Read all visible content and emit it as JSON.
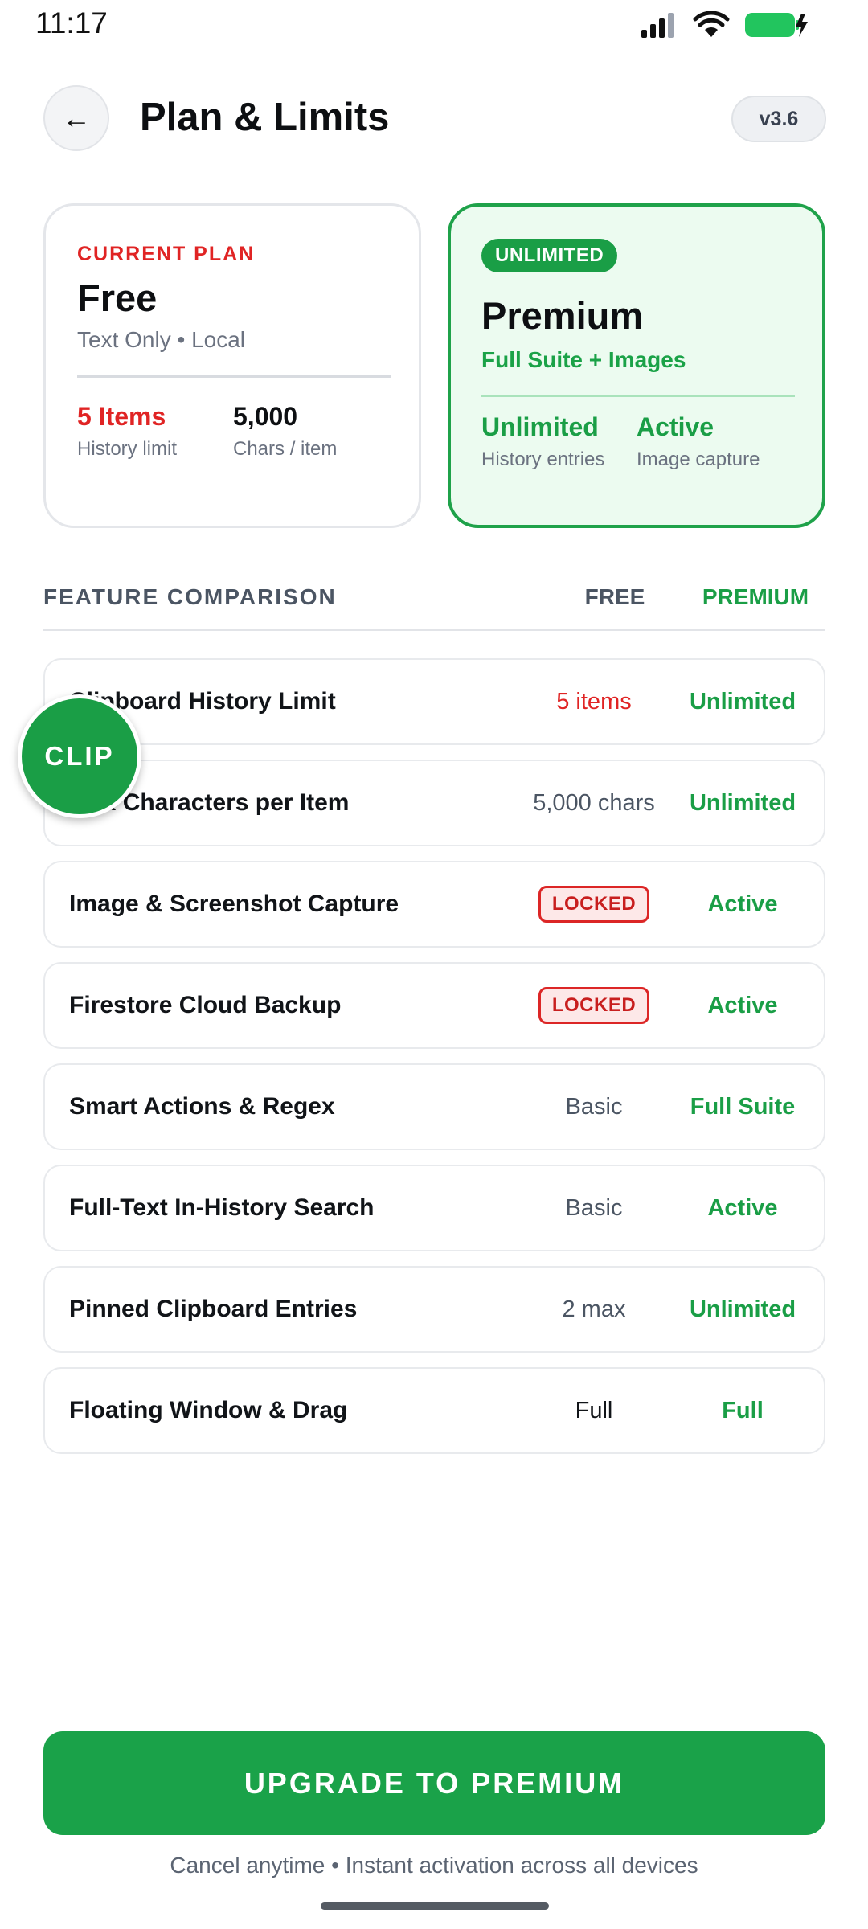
{
  "status_bar": {
    "time": "11:17"
  },
  "header": {
    "back_icon": "←",
    "title": "Plan & Limits",
    "version": "v3.6"
  },
  "free_plan": {
    "tag": "CURRENT PLAN",
    "name": "Free",
    "subtitle": "Text Only • Local",
    "stats": [
      {
        "value": "5 Items",
        "label": "History limit"
      },
      {
        "value": "5,000",
        "label": "Chars / item"
      }
    ]
  },
  "premium_plan": {
    "badge": "UNLIMITED",
    "name": "Premium",
    "subtitle": "Full Suite + Images",
    "stats": [
      {
        "value": "Unlimited",
        "label": "History entries"
      },
      {
        "value": "Active",
        "label": "Image capture"
      }
    ]
  },
  "comparison": {
    "title": "FEATURE COMPARISON",
    "col_free": "FREE",
    "col_premium": "PREMIUM",
    "rows": [
      {
        "label": "Clipboard History Limit",
        "free": "5 items",
        "premium": "Unlimited"
      },
      {
        "label": "Max Characters per Item",
        "free": "5,000 chars",
        "premium": "Unlimited"
      },
      {
        "label": "Image & Screenshot Capture",
        "free": "LOCKED",
        "premium": "Active"
      },
      {
        "label": "Firestore Cloud Backup",
        "free": "LOCKED",
        "premium": "Active"
      },
      {
        "label": "Smart Actions & Regex",
        "free": "Basic",
        "premium": "Full Suite"
      },
      {
        "label": "Full-Text In-History Search",
        "free": "Basic",
        "premium": "Active"
      },
      {
        "label": "Pinned Clipboard Entries",
        "free": "2 max",
        "premium": "Unlimited"
      },
      {
        "label": "Floating Window & Drag",
        "free": "Full",
        "premium": "Full"
      }
    ]
  },
  "floating_bubble": {
    "label": "CLIP"
  },
  "upgrade": {
    "button_label": "UPGRADE TO PREMIUM",
    "note": "Cancel anytime • Instant activation across all devices"
  },
  "colors": {
    "brand_green": "#1a9e46",
    "limit_red": "#e02424"
  }
}
